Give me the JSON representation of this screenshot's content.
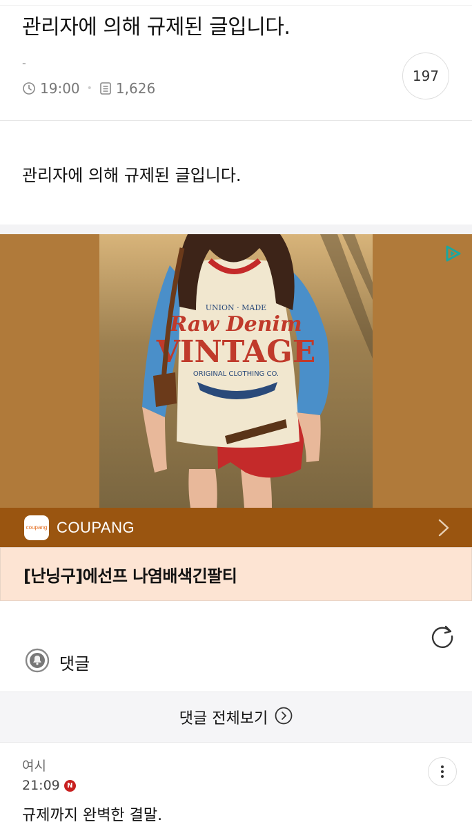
{
  "post": {
    "title": "관리자에 의해 규제된 글입니다.",
    "author": "-",
    "time": "19:00",
    "views": "1,626",
    "comment_count": "197",
    "body": "관리자에 의해 규제된 글입니다."
  },
  "ad": {
    "brand": "COUPANG",
    "logo_text": "coupang",
    "product_title": "[난닝구]에선프 나염배색긴팔티",
    "icons": {
      "play": "ad-choices-icon",
      "chevron": "chevron-right-icon"
    },
    "colors": {
      "brand_bar": "#9a5510",
      "product_bg": "#fde4d3",
      "image_bg": "#b07a3a"
    }
  },
  "comments": {
    "header_label": "댓글",
    "view_all_label": "댓글 전체보기",
    "items": [
      {
        "author": "여시",
        "time": "21:09",
        "badge": "N",
        "text": "규제까지 완벽한 결말."
      }
    ]
  }
}
